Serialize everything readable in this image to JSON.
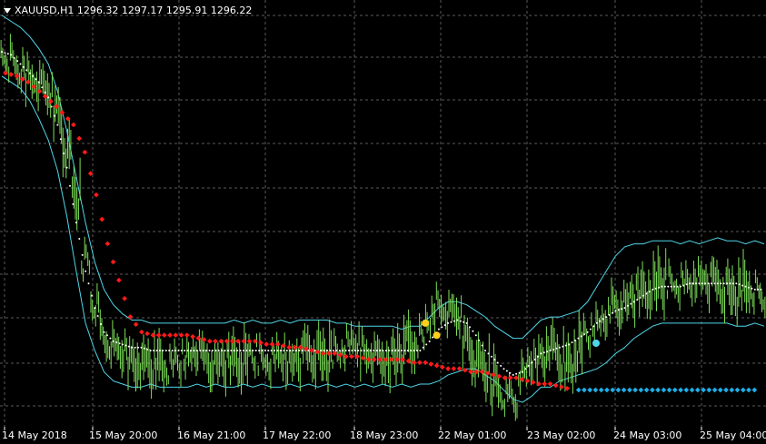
{
  "header": {
    "symbol": "XAUUSD,H1",
    "open": "1296.32",
    "high": "1297.17",
    "low": "1295.91",
    "close": "1296.22"
  },
  "chart_data": {
    "type": "line",
    "background": "#000000",
    "grid": true,
    "grid_color": "#5a5a5a",
    "x_tick_labels": [
      "14 May 2018",
      "15 May 20:00",
      "16 May 21:00",
      "17 May 22:00",
      "18 May 23:00",
      "22 May 01:00",
      "23 May 02:00",
      "24 May 03:00",
      "25 May 04:00"
    ],
    "price_color": "#7ee05a",
    "band_color": "#4fd6e8",
    "midline_color": "#ffffff",
    "sar_down_color": "#ff1a1a",
    "sar_up_color": "#1eaee8",
    "signal_color": "#ffd21a",
    "close": [
      2,
      5,
      9,
      10,
      12,
      15,
      22,
      35,
      50,
      70,
      85,
      96,
      99,
      101,
      103,
      104,
      105,
      104,
      106,
      104,
      102,
      100,
      103,
      105,
      104,
      102,
      103,
      101,
      103,
      104,
      102,
      104,
      102,
      100,
      101,
      103,
      100,
      98,
      97,
      101,
      102,
      104,
      102,
      100,
      98,
      96,
      90,
      85,
      87,
      88,
      97,
      104,
      107,
      110,
      115,
      116,
      108,
      104,
      102,
      98,
      103,
      105,
      100,
      95,
      91,
      89,
      85,
      85,
      82,
      80,
      79,
      77,
      78,
      79,
      78,
      76,
      77,
      78,
      80,
      82,
      79,
      80,
      84
    ],
    "mid": [
      2,
      3,
      6,
      9,
      12,
      17,
      26,
      40,
      58,
      74,
      86,
      94,
      97,
      98,
      99,
      99,
      100,
      100,
      100,
      100,
      100,
      100,
      100,
      100,
      100,
      100,
      100,
      100,
      100,
      100,
      100,
      100,
      100,
      100,
      100,
      100,
      100,
      100,
      100,
      100,
      100,
      100,
      100,
      100,
      100,
      100,
      97,
      93,
      91,
      90,
      91,
      95,
      100,
      103,
      106,
      108,
      107,
      104,
      101,
      100,
      99,
      98,
      96,
      94,
      91,
      89,
      87,
      86,
      84,
      82,
      80,
      79,
      79,
      79,
      78,
      78,
      78,
      78,
      78,
      78,
      79,
      80,
      80
    ],
    "upper": [
      -10,
      -8,
      -6,
      -3,
      1,
      6,
      15,
      28,
      43,
      58,
      71,
      80,
      85,
      88,
      90,
      90,
      91,
      91,
      91,
      91,
      91,
      91,
      91,
      91,
      91,
      90,
      91,
      90,
      91,
      91,
      90,
      91,
      90,
      90,
      90,
      90,
      91,
      91,
      92,
      92,
      92,
      92,
      92,
      93,
      92,
      92,
      89,
      86,
      84,
      84,
      85,
      87,
      89,
      92,
      94,
      96,
      96,
      93,
      90,
      89,
      89,
      88,
      87,
      84,
      79,
      74,
      69,
      66,
      65,
      65,
      64,
      64,
      64,
      65,
      64,
      65,
      64,
      63,
      64,
      64,
      65,
      64,
      65
    ],
    "lower": [
      10,
      12,
      14,
      18,
      24,
      31,
      41,
      56,
      74,
      91,
      100,
      107,
      110,
      111,
      112,
      112,
      111,
      112,
      112,
      112,
      112,
      111,
      112,
      111,
      112,
      112,
      111,
      112,
      111,
      112,
      112,
      111,
      112,
      111,
      112,
      111,
      112,
      111,
      112,
      111,
      112,
      111,
      112,
      111,
      112,
      111,
      111,
      110,
      108,
      107,
      106,
      106,
      108,
      110,
      113,
      116,
      117,
      115,
      112,
      112,
      110,
      109,
      108,
      107,
      106,
      104,
      101,
      99,
      96,
      94,
      92,
      91,
      91,
      91,
      91,
      91,
      91,
      91,
      91,
      92,
      92,
      91,
      92
    ],
    "sar_down": [
      [
        0,
        0
      ],
      [
        2,
        1
      ],
      [
        4,
        3
      ],
      [
        6,
        6
      ],
      [
        9,
        11
      ],
      [
        12,
        17
      ],
      [
        14,
        26
      ],
      [
        16,
        40
      ],
      [
        18,
        56
      ],
      [
        20,
        68
      ],
      [
        22,
        80
      ],
      [
        24,
        85
      ],
      [
        26,
        86
      ],
      [
        30,
        86
      ],
      [
        32,
        86
      ],
      [
        34,
        87
      ],
      [
        36,
        88
      ],
      [
        38,
        88
      ],
      [
        40,
        88
      ],
      [
        42,
        88
      ],
      [
        44,
        88
      ],
      [
        46,
        89
      ],
      [
        48,
        89
      ],
      [
        50,
        90
      ],
      [
        52,
        90
      ],
      [
        54,
        91
      ],
      [
        56,
        92
      ],
      [
        58,
        92
      ],
      [
        60,
        93
      ],
      [
        62,
        93
      ],
      [
        64,
        94
      ],
      [
        66,
        94
      ],
      [
        68,
        94
      ],
      [
        70,
        94
      ],
      [
        72,
        95
      ],
      [
        74,
        95
      ],
      [
        76,
        96
      ],
      [
        78,
        97
      ],
      [
        80,
        97
      ],
      [
        82,
        98
      ],
      [
        84,
        98
      ],
      [
        86,
        99
      ],
      [
        88,
        100
      ],
      [
        90,
        100
      ],
      [
        92,
        101
      ],
      [
        94,
        102
      ],
      [
        96,
        102
      ],
      [
        98,
        103
      ],
      [
        100,
        104
      ]
    ],
    "sar_up": [
      [
        101,
        104
      ],
      [
        103,
        104
      ],
      [
        105,
        104
      ],
      [
        107,
        104
      ],
      [
        109,
        104
      ],
      [
        111,
        104
      ],
      [
        113,
        104
      ],
      [
        115,
        104
      ],
      [
        117,
        104
      ],
      [
        119,
        104
      ],
      [
        121,
        104
      ],
      [
        123,
        104
      ],
      [
        125,
        104
      ],
      [
        127,
        104
      ],
      [
        129,
        104
      ],
      [
        131,
        104
      ],
      [
        133,
        104
      ]
    ],
    "signals": [
      [
        74,
        91
      ],
      [
        76,
        95
      ]
    ],
    "ylim": [
      -15,
      125
    ]
  }
}
